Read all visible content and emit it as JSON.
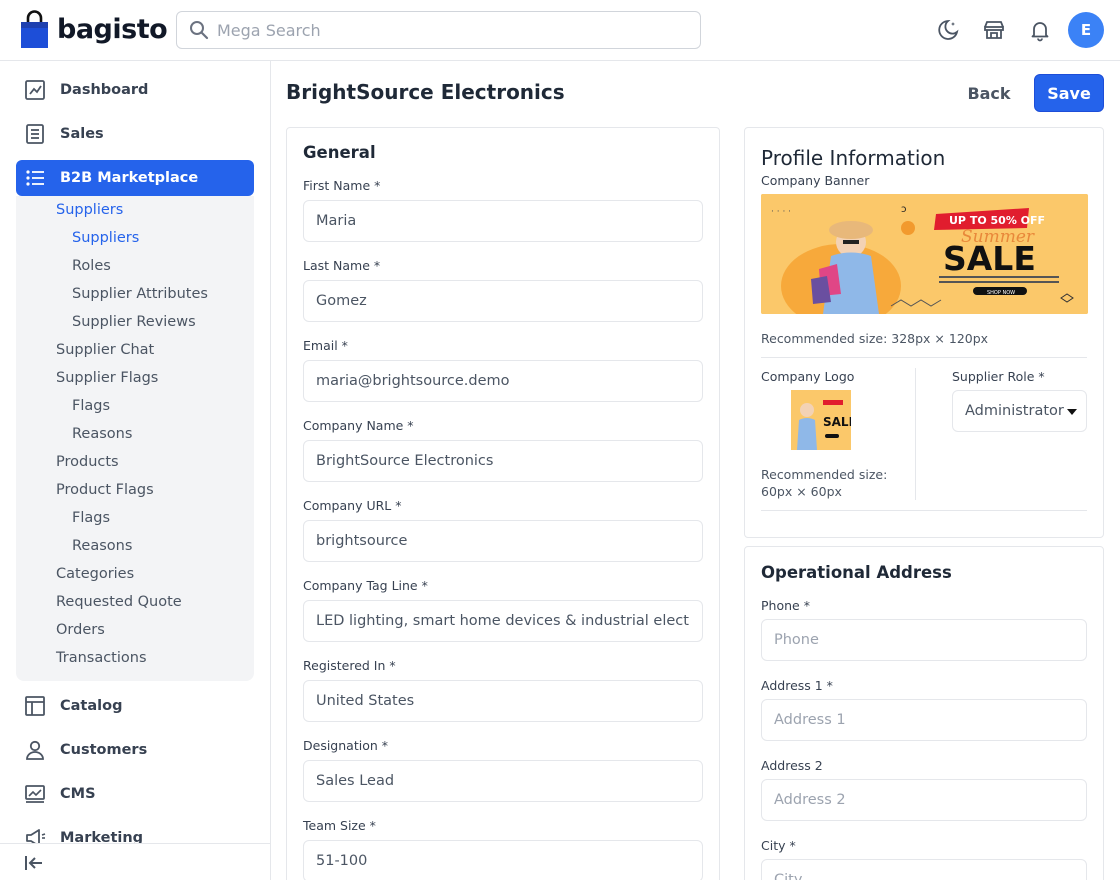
{
  "header": {
    "brand": "bagisto",
    "search_placeholder": "Mega Search",
    "avatar_initial": "E"
  },
  "sidebar": {
    "main_top": [
      {
        "label": "Dashboard",
        "icon": "dashboard-icon"
      },
      {
        "label": "Sales",
        "icon": "sales-icon"
      },
      {
        "label": "B2B Marketplace",
        "icon": "marketplace-icon",
        "active": true
      }
    ],
    "submenu": [
      {
        "label": "Suppliers",
        "level": 1,
        "active": true
      },
      {
        "label": "Suppliers",
        "level": 2,
        "active": true
      },
      {
        "label": "Roles",
        "level": 2
      },
      {
        "label": "Supplier Attributes",
        "level": 2
      },
      {
        "label": "Supplier Reviews",
        "level": 2
      },
      {
        "label": "Supplier Chat",
        "level": 1
      },
      {
        "label": "Supplier Flags",
        "level": 1
      },
      {
        "label": "Flags",
        "level": 2
      },
      {
        "label": "Reasons",
        "level": 2
      },
      {
        "label": "Products",
        "level": 1
      },
      {
        "label": "Product Flags",
        "level": 1
      },
      {
        "label": "Flags",
        "level": 2
      },
      {
        "label": "Reasons",
        "level": 2
      },
      {
        "label": "Categories",
        "level": 1
      },
      {
        "label": "Requested Quote",
        "level": 1
      },
      {
        "label": "Orders",
        "level": 1
      },
      {
        "label": "Transactions",
        "level": 1
      }
    ],
    "main_bottom": [
      {
        "label": "Catalog",
        "icon": "catalog-icon"
      },
      {
        "label": "Customers",
        "icon": "customers-icon"
      },
      {
        "label": "CMS",
        "icon": "cms-icon"
      },
      {
        "label": "Marketing",
        "icon": "marketing-icon"
      }
    ]
  },
  "page": {
    "title": "BrightSource Electronics",
    "back_label": "Back",
    "save_label": "Save"
  },
  "general": {
    "title": "General",
    "fields": [
      {
        "label": "First Name *",
        "value": "Maria"
      },
      {
        "label": "Last Name *",
        "value": "Gomez"
      },
      {
        "label": "Email *",
        "value": "maria@brightsource.demo"
      },
      {
        "label": "Company Name *",
        "value": "BrightSource Electronics"
      },
      {
        "label": "Company URL *",
        "value": "brightsource"
      },
      {
        "label": "Company Tag Line *",
        "value": "LED lighting, smart home devices & industrial electronics"
      },
      {
        "label": "Registered In *",
        "value": "United States"
      },
      {
        "label": "Designation *",
        "value": "Sales Lead"
      },
      {
        "label": "Team Size *",
        "value": "51-100"
      }
    ]
  },
  "profile": {
    "title": "Profile Information",
    "banner_label": "Company Banner",
    "banner_text": {
      "badge": "UP TO 50% OFF",
      "script": "Summer",
      "sale": "SALE",
      "cta": "SHOP NOW"
    },
    "banner_hint": "Recommended size: 328px × 120px",
    "logo_label": "Company Logo",
    "logo_text": "SALE",
    "logo_hint_1": "Recommended size:",
    "logo_hint_2": "60px × 60px",
    "role_label": "Supplier Role *",
    "role_value": "Administrator"
  },
  "address": {
    "title": "Operational Address",
    "fields": [
      {
        "label": "Phone *",
        "placeholder": "Phone"
      },
      {
        "label": "Address 1 *",
        "placeholder": "Address 1"
      },
      {
        "label": "Address 2",
        "placeholder": "Address 2"
      },
      {
        "label": "City *",
        "placeholder": "City"
      }
    ]
  },
  "colors": {
    "primary": "#2563eb",
    "avatar": "#3b82f6",
    "banner_bg": "#fbc86a"
  }
}
